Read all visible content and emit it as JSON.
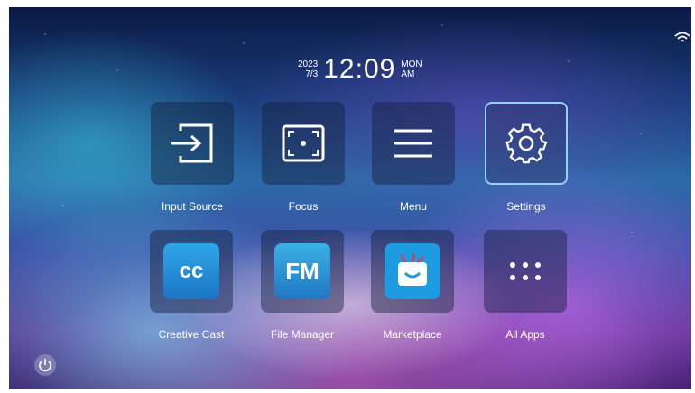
{
  "clock": {
    "year": "2023",
    "date": "7/3",
    "time": "12:09",
    "weekday": "MON",
    "ampm": "AM"
  },
  "apps_row1": [
    {
      "label": "Input Source",
      "icon": "input-source-icon"
    },
    {
      "label": "Focus",
      "icon": "focus-icon"
    },
    {
      "label": "Menu",
      "icon": "menu-icon"
    },
    {
      "label": "Settings",
      "icon": "gear-icon"
    }
  ],
  "apps_row2": [
    {
      "label": "Creative Cast",
      "icon": "creative-cast-icon",
      "icon_text": "cc"
    },
    {
      "label": "File Manager",
      "icon": "file-manager-icon",
      "icon_text": "FM"
    },
    {
      "label": "Marketplace",
      "icon": "marketplace-icon"
    },
    {
      "label": "All Apps",
      "icon": "grid-dots-icon"
    }
  ],
  "colors": {
    "focus_border": "#8fd3ff",
    "app_blue": "#2a8fd6"
  }
}
